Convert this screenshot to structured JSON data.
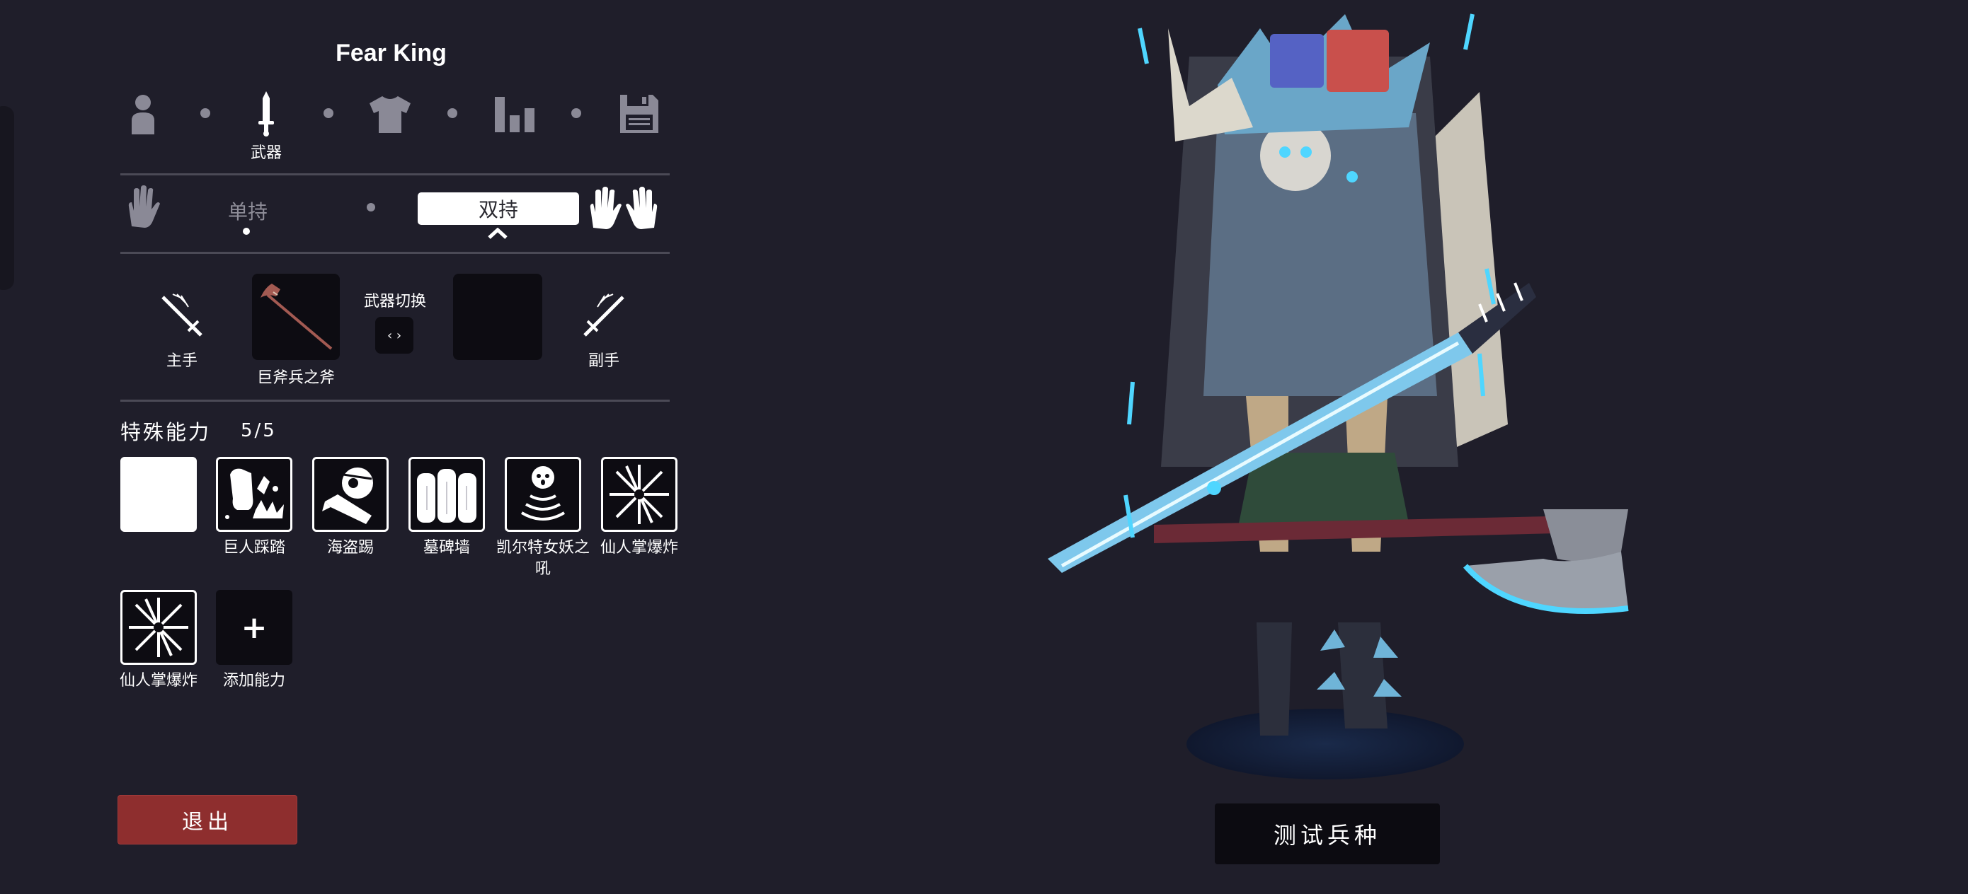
{
  "unit": {
    "name": "Fear King"
  },
  "steps": [
    {
      "icon": "person-icon",
      "label": ""
    },
    {
      "icon": "sword-icon",
      "label": "武器"
    },
    {
      "icon": "shirt-icon",
      "label": ""
    },
    {
      "icon": "stats-icon",
      "label": ""
    },
    {
      "icon": "save-icon",
      "label": ""
    }
  ],
  "grip": {
    "single_label": "单持",
    "dual_label": "双持",
    "single_icon": "one-hand-icon",
    "dual_icon": "two-hands-icon"
  },
  "weapons": {
    "main_label": "主手",
    "main_weapon_name": "巨斧兵之斧",
    "swap_label": "武器切换",
    "swap_glyph": "‹ ›",
    "off_label": "副手"
  },
  "abilities": {
    "title": "特殊能力",
    "count": "5/5",
    "items": [
      {
        "label": "",
        "icon": "blank-slot"
      },
      {
        "label": "巨人踩踏",
        "icon": "giant-stomp-icon"
      },
      {
        "label": "海盗踢",
        "icon": "pirate-kick-icon"
      },
      {
        "label": "墓碑墙",
        "icon": "tombstone-wall-icon"
      },
      {
        "label": "凯尔特女妖之吼",
        "icon": "banshee-scream-icon"
      },
      {
        "label": "仙人掌爆炸",
        "icon": "cactus-explosion-icon"
      },
      {
        "label": "仙人掌爆炸",
        "icon": "cactus-explosion-icon"
      },
      {
        "label": "添加能力",
        "icon": "plus-icon",
        "glyph": "+"
      }
    ]
  },
  "buttons": {
    "exit_label": "退出",
    "test_label": "测试兵种"
  },
  "colors": {
    "background": "#1f1e2a",
    "team_blue": "#5562c4",
    "team_red": "#c9504c",
    "exit": "#8e2e2e",
    "glow": "#4fd6ff"
  }
}
